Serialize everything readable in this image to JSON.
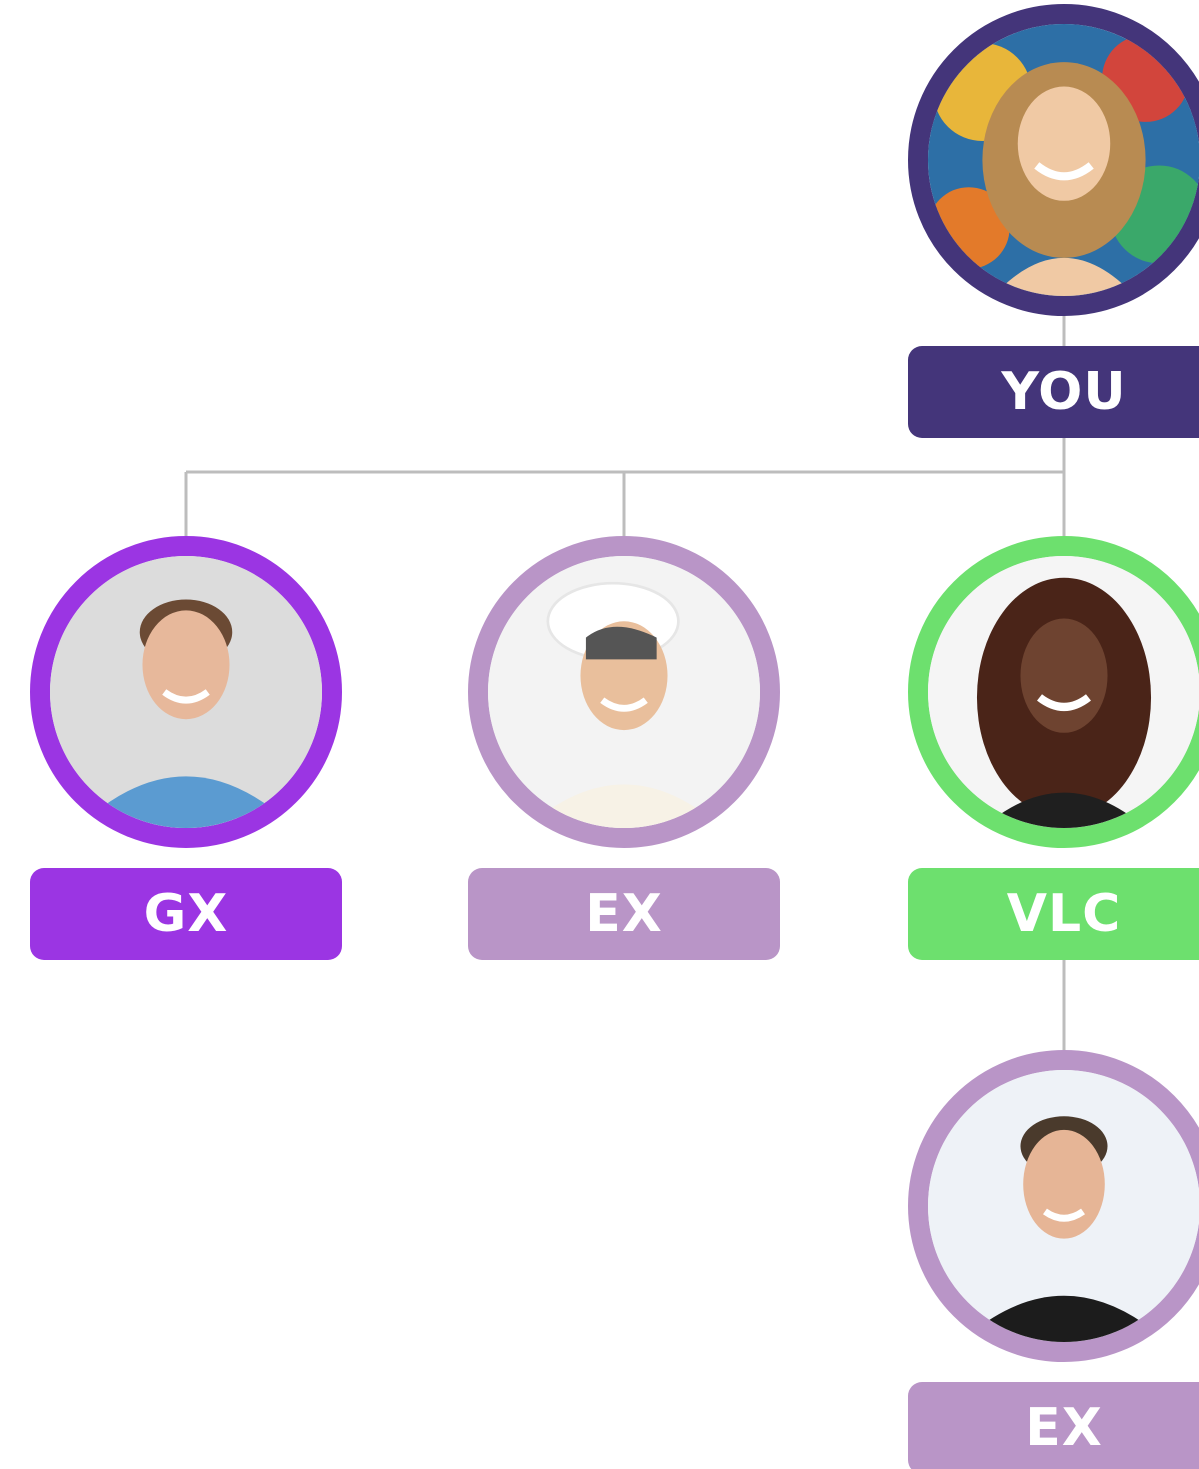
{
  "colors": {
    "you": "#44357a",
    "gx": "#9b35e3",
    "ex": "#b995c7",
    "vlc": "#6de06e",
    "connector": "#bdbdbd"
  },
  "nodes": {
    "you": {
      "label": "YOU",
      "icon": "woman-avatar-icon"
    },
    "gx": {
      "label": "GX",
      "icon": "man-avatar-icon"
    },
    "ex1": {
      "label": "EX",
      "icon": "woman-avatar-icon"
    },
    "vlc": {
      "label": "VLC",
      "icon": "woman-avatar-icon"
    },
    "ex2": {
      "label": "EX",
      "icon": "man-avatar-icon"
    }
  }
}
